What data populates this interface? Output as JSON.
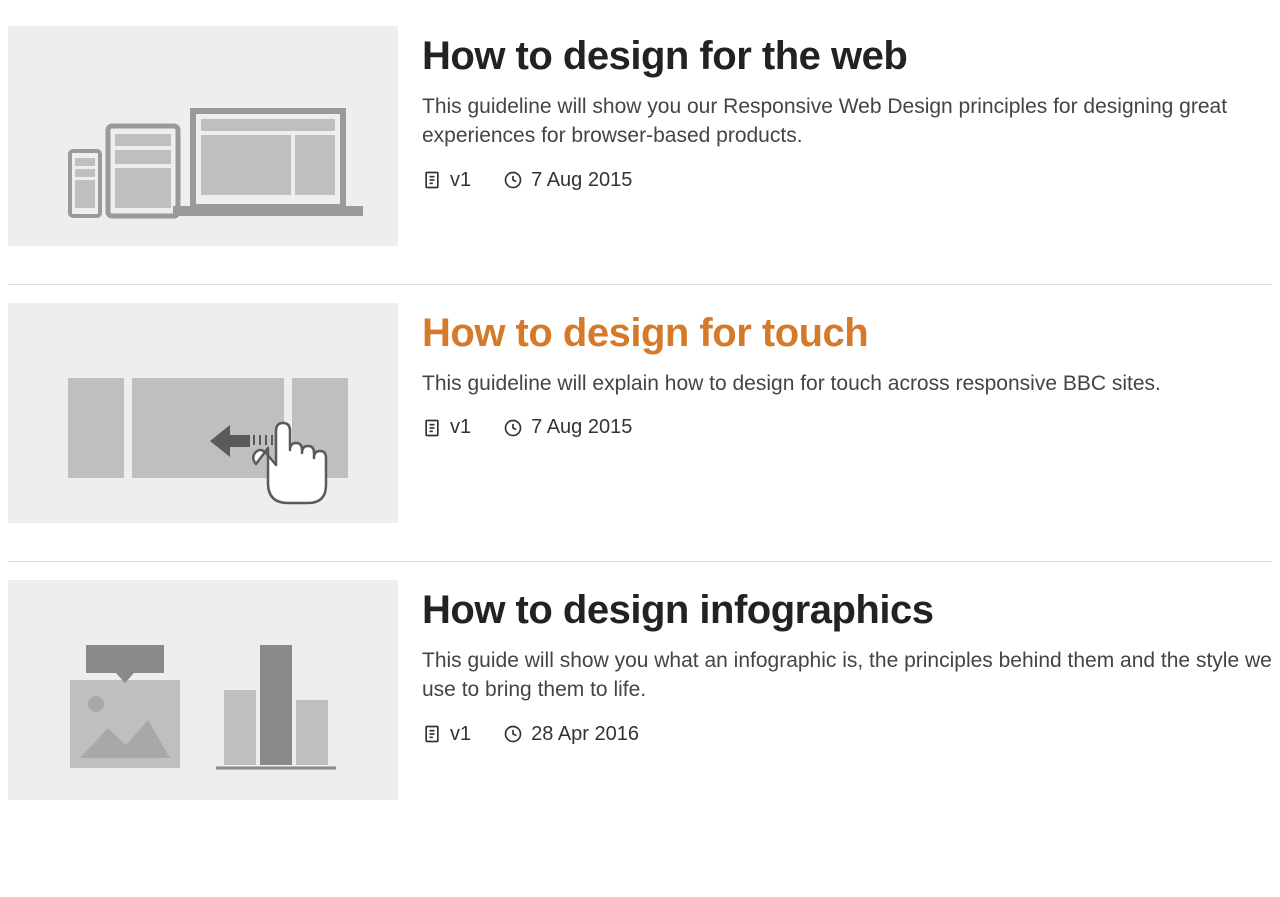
{
  "articles": [
    {
      "title": "How to design for the web",
      "description": "This guideline will show you our Responsive Web Design principles for designing great experiences for browser-based products.",
      "version": "v1",
      "date": "7 Aug 2015",
      "highlighted": false,
      "thumbnail": "devices-icon"
    },
    {
      "title": "How to design for touch",
      "description": "This guideline will explain how to design for touch across responsive BBC sites.",
      "version": "v1",
      "date": "7 Aug 2015",
      "highlighted": true,
      "thumbnail": "touch-swipe-icon"
    },
    {
      "title": "How to design infographics",
      "description": "This guide will show you what an infographic is, the principles behind them and the style we use to bring them to life.",
      "version": "v1",
      "date": "28 Apr 2016",
      "highlighted": false,
      "thumbnail": "infographic-icon"
    }
  ]
}
